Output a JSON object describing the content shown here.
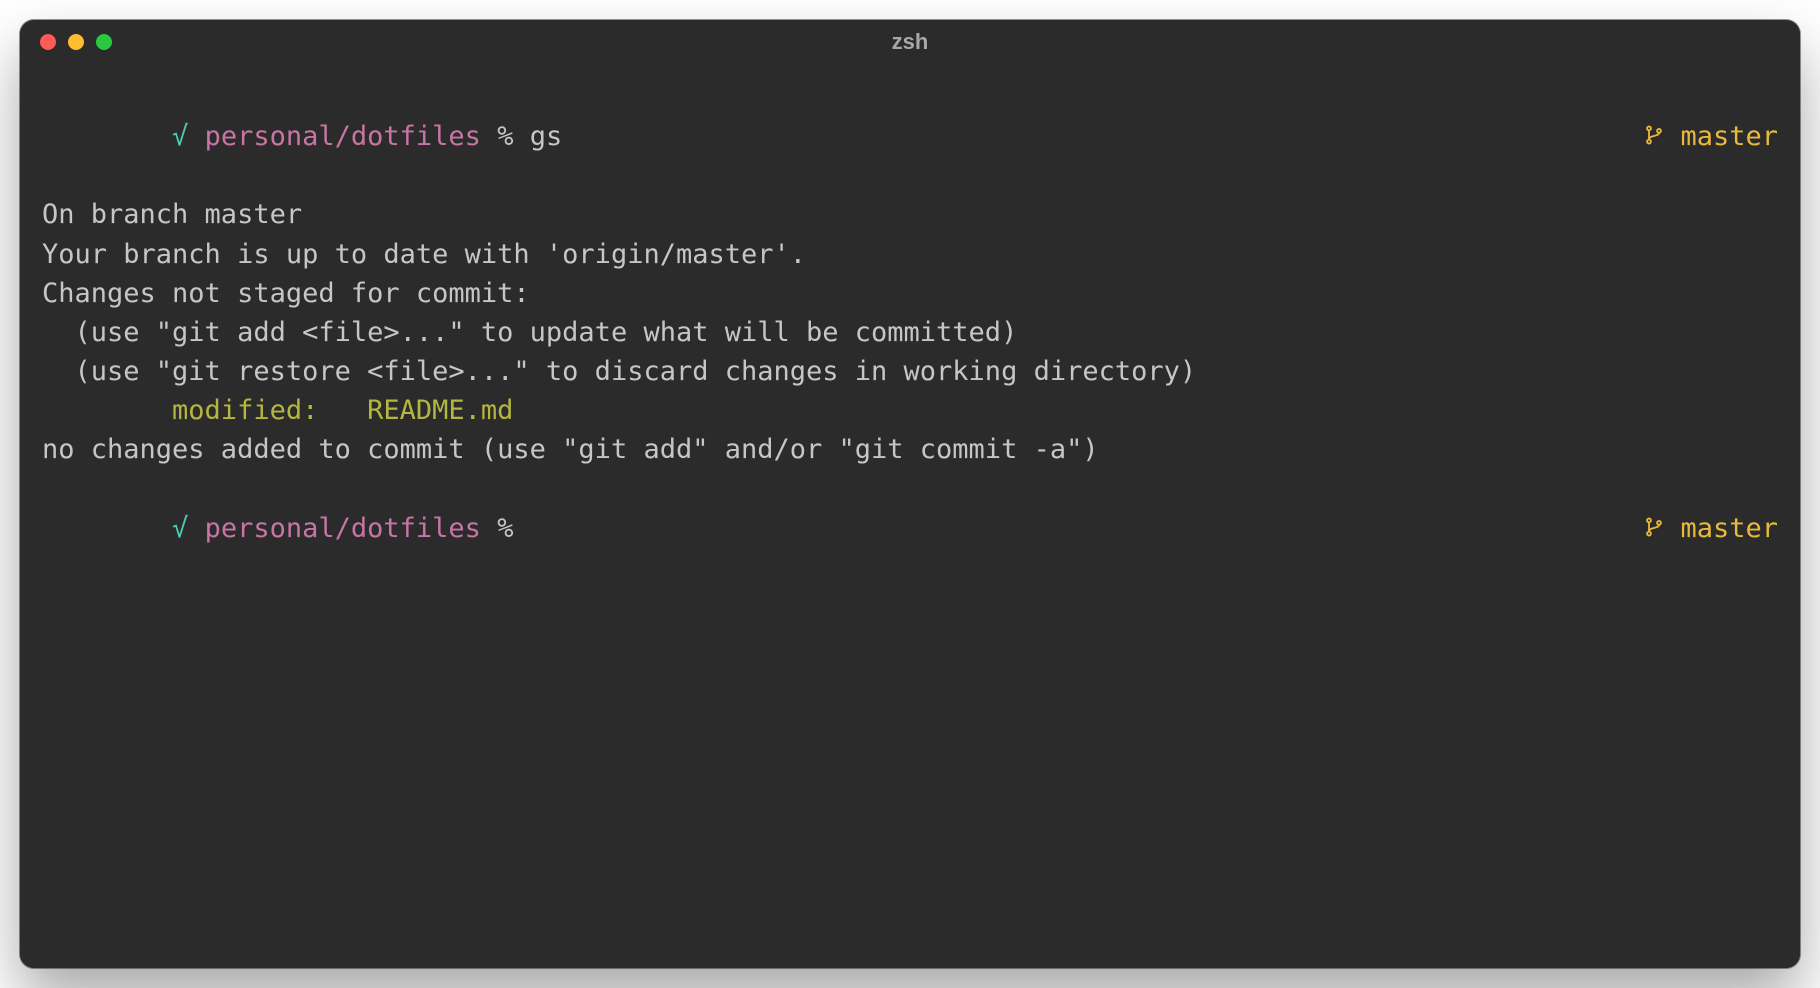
{
  "titlebar": {
    "title": "zsh"
  },
  "prompt1": {
    "check": "√",
    "path": "personal/dotfiles",
    "symbol": "%",
    "cmd": "gs",
    "branch": "master"
  },
  "output": {
    "l1": "On branch master",
    "l2": "Your branch is up to date with 'origin/master'.",
    "l3": "",
    "l4": "Changes not staged for commit:",
    "l5": "  (use \"git add <file>...\" to update what will be committed)",
    "l6": "  (use \"git restore <file>...\" to discard changes in working directory)",
    "l7": "        modified:   README.md",
    "l8": "",
    "l9": "no changes added to commit (use \"git add\" and/or \"git commit -a\")"
  },
  "prompt2": {
    "check": "√",
    "path": "personal/dotfiles",
    "symbol": "%",
    "branch": "master"
  }
}
